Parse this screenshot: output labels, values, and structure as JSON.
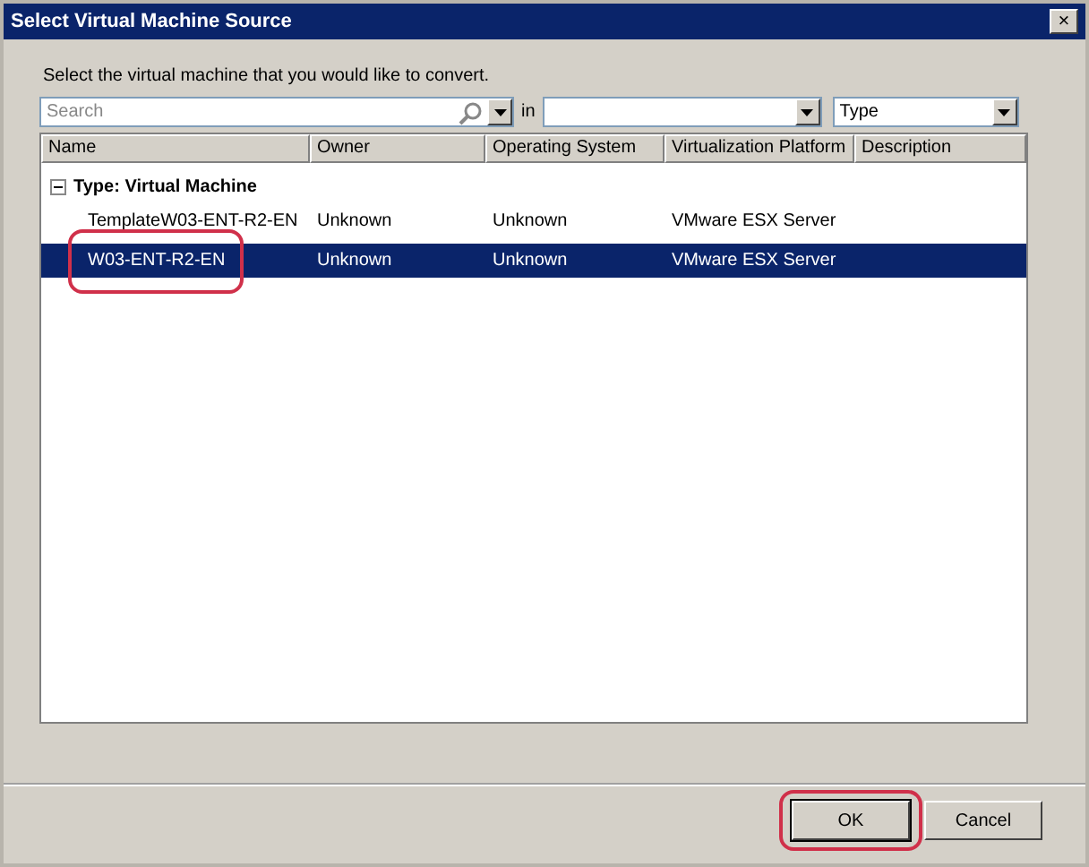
{
  "window": {
    "title": "Select Virtual Machine Source",
    "close": "×"
  },
  "prompt": "Select the virtual machine that you would like to convert.",
  "search": {
    "placeholder": "Search",
    "in_label": "in",
    "group_by": "Type"
  },
  "table": {
    "columns": [
      "Name",
      "Owner",
      "Operating System",
      "Virtualization Platform",
      "Description"
    ],
    "group": {
      "label": "Type: Virtual Machine",
      "expanded": true
    },
    "rows": [
      {
        "cells": [
          "TemplateW03-ENT-R2-EN",
          "Unknown",
          "Unknown",
          "VMware ESX Server"
        ],
        "selected": false,
        "circled": false
      },
      {
        "cells": [
          "W03-ENT-R2-EN",
          "Unknown",
          "Unknown",
          "VMware ESX Server"
        ],
        "selected": true,
        "circled": true
      }
    ]
  },
  "buttons": [
    {
      "label": "OK",
      "circled": true,
      "default": true
    },
    {
      "label": "Cancel",
      "circled": false,
      "default": false
    }
  ]
}
